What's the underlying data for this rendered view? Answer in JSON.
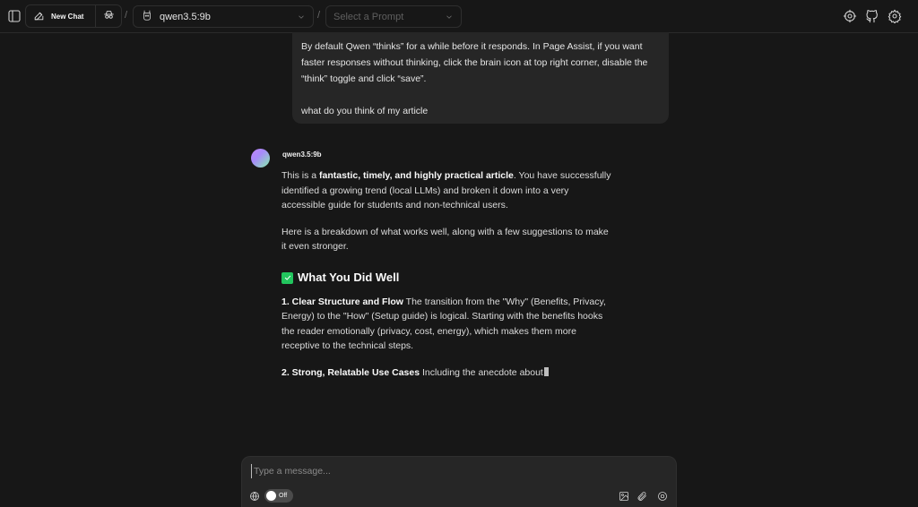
{
  "header": {
    "new_chat_label": "New Chat",
    "model_name": "qwen3.5:9b",
    "prompt_placeholder": "Select a Prompt",
    "separator": "/"
  },
  "conversation": {
    "user_message": {
      "paragraph_1": "By default Qwen “thinks” for a while before it responds. In Page Assist, if you want faster responses without thinking, click the brain icon at top right corner, disable the “think” toggle and click “save”.",
      "paragraph_2": "what do you think of my article"
    },
    "assistant": {
      "model_label": "qwen3.5:9b",
      "p1_prefix": "This is a ",
      "p1_bold": "fantastic, timely, and highly practical article",
      "p1_suffix": ". You have successfully identified a growing trend (local LLMs) and broken it down into a very accessible guide for students and non-technical users.",
      "p2": "Here is a breakdown of what works well, along with a few suggestions to make it even stronger.",
      "section_heading": "What You Did Well",
      "item1_bold": "1. Clear Structure and Flow",
      "item1_text": " The transition from the \"Why\" (Benefits, Privacy, Energy) to the \"How\" (Setup guide) is logical. Starting with the benefits hooks the reader emotionally (privacy, cost, energy), which makes them more receptive to the technical steps.",
      "item2_bold": "2. Strong, Relatable Use Cases",
      "item2_text": " Including the anecdote about"
    }
  },
  "composer": {
    "placeholder": "Type a message...",
    "web_search_toggle_label": "Off"
  },
  "icons": {
    "sidebar_toggle": "sidebar-icon",
    "new_chat": "pencil-square-icon",
    "incognito": "incognito-icon",
    "model": "llama-icon",
    "brain_settings": "brain-settings-icon",
    "github": "github-icon",
    "settings": "gear-icon",
    "globe": "globe-icon",
    "image": "image-icon",
    "attach": "paperclip-icon",
    "stop": "stop-circle-icon"
  },
  "colors": {
    "background": "#171717",
    "bubble": "#262626",
    "check_green": "#22c55e"
  }
}
